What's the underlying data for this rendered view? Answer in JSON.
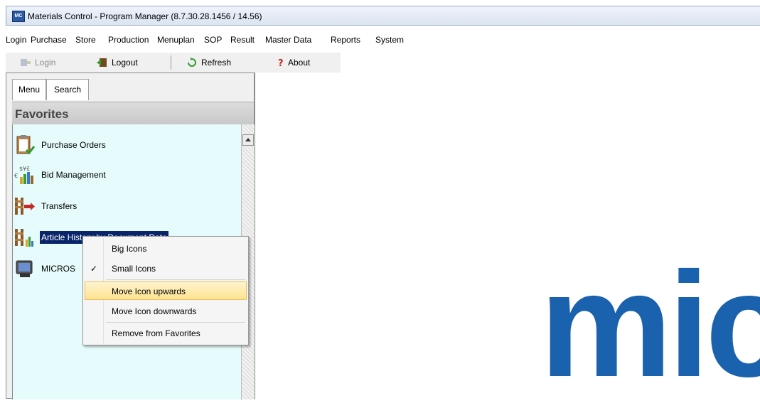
{
  "window": {
    "title": "Materials Control - Program Manager (8.7.30.28.1456 / 14.56)",
    "app_icon_text": "MC"
  },
  "menubar": [
    "Login",
    "Purchase",
    "Store",
    "Production",
    "Menuplan",
    "SOP",
    "Result",
    "Master Data",
    "Reports",
    "System"
  ],
  "toolbar": {
    "login": "Login",
    "logout": "Logout",
    "refresh": "Refresh",
    "about": "About"
  },
  "left_panel": {
    "tabs": [
      "Menu",
      "Search"
    ],
    "header": "Favorites",
    "items": [
      {
        "label": "Purchase Orders",
        "icon": "clipboard-icon"
      },
      {
        "label": "Bid Management",
        "icon": "currency-chart-icon"
      },
      {
        "label": "Transfers",
        "icon": "transfer-icon"
      },
      {
        "label": "Article History by Document Date",
        "icon": "article-history-icon",
        "selected": true
      },
      {
        "label": "MICROS",
        "icon": "pos-terminal-icon"
      }
    ]
  },
  "context_menu": {
    "items": [
      {
        "label": "Big Icons",
        "checked": false,
        "highlighted": false
      },
      {
        "label": "Small Icons",
        "checked": true,
        "highlighted": false
      },
      {
        "label": "Move Icon upwards",
        "checked": false,
        "highlighted": true
      },
      {
        "label": "Move Icon downwards",
        "checked": false,
        "highlighted": false
      },
      {
        "label": "Remove from Favorites",
        "checked": false,
        "highlighted": false
      }
    ]
  },
  "main": {
    "logo_partial_text": "mic"
  },
  "colors": {
    "selection": "#0a246a",
    "logo": "#1a62ae",
    "list_background": "#e6fbfb",
    "highlight": "#fde38f"
  }
}
